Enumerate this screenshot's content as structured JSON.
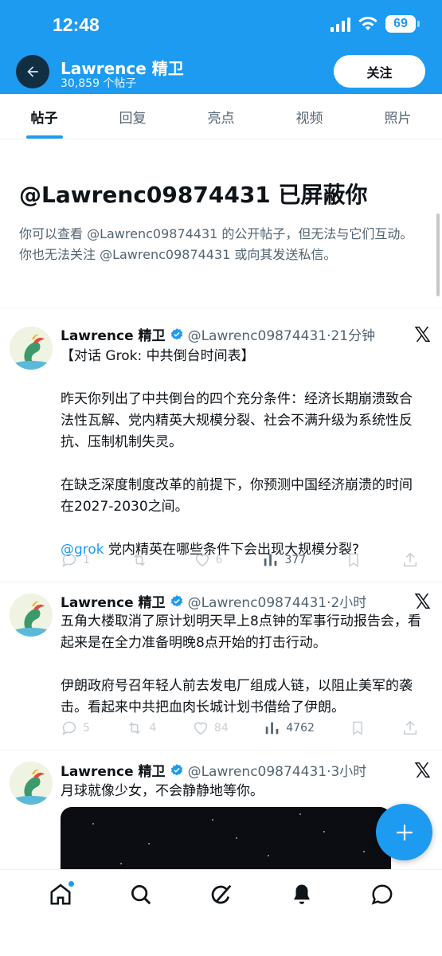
{
  "status_bar": {
    "time": "12:48",
    "battery": "69"
  },
  "header": {
    "title": "Lawrence 精卫",
    "post_count": "30,859 个帖子",
    "follow_label": "关注"
  },
  "tabs": [
    {
      "label": "帖子",
      "active": true
    },
    {
      "label": "回复",
      "active": false
    },
    {
      "label": "亮点",
      "active": false
    },
    {
      "label": "视频",
      "active": false
    },
    {
      "label": "照片",
      "active": false
    }
  ],
  "blocked_notice": {
    "title": "@Lawrenc09874431 已屏蔽你",
    "body": "你可以查看 @Lawrenc09874431 的公开帖子，但无法与它们互动。你也无法关注 @Lawrenc09874431 或向其发送私信。"
  },
  "posts": [
    {
      "name": "Lawrence 精卫",
      "handle_time": "@Lawrenc09874431·21分钟",
      "text": "【对话 Grok: 中共倒台时间表】\n\n昨天你列出了中共倒台的四个充分条件：经济长期崩溃致合法性瓦解、党内精英大规模分裂、社会不满升级为系统性反抗、压制机制失灵。\n\n在缺乏深度制度改革的前提下，你预测中国经济崩溃的时间在2027-2030之间。\n\n",
      "mention": "@grok",
      "text_after_mention": " 党内精英在哪些条件下会出现大规模分裂?",
      "replies": "1",
      "reposts": "",
      "likes": "6",
      "views": "377"
    },
    {
      "name": "Lawrence 精卫",
      "handle_time": "@Lawrenc09874431·2小时",
      "text": "五角大楼取消了原计划明天早上8点钟的军事行动报告会，看起来是在全力准备明晚8点开始的打击行动。\n\n伊朗政府号召年轻人前去发电厂组成人链，以阻止美军的袭击。看起来中共把血肉长城计划书借给了伊朗。",
      "replies": "5",
      "reposts": "4",
      "likes": "84",
      "views": "4762"
    },
    {
      "name": "Lawrence 精卫",
      "handle_time": "@Lawrenc09874431·3小时",
      "text": "月球就像少女，不会静静地等你。"
    }
  ],
  "icons": {
    "back": "arrow-left-icon",
    "verified": "verified-badge-icon",
    "x_logo": "x-logo-icon",
    "compose": "plus-icon",
    "nav": [
      "home-icon",
      "search-icon",
      "grok-icon",
      "notifications-icon",
      "messages-icon"
    ]
  },
  "colors": {
    "brand": "#1d9bf0",
    "text": "#0f1419",
    "muted": "#536471"
  }
}
